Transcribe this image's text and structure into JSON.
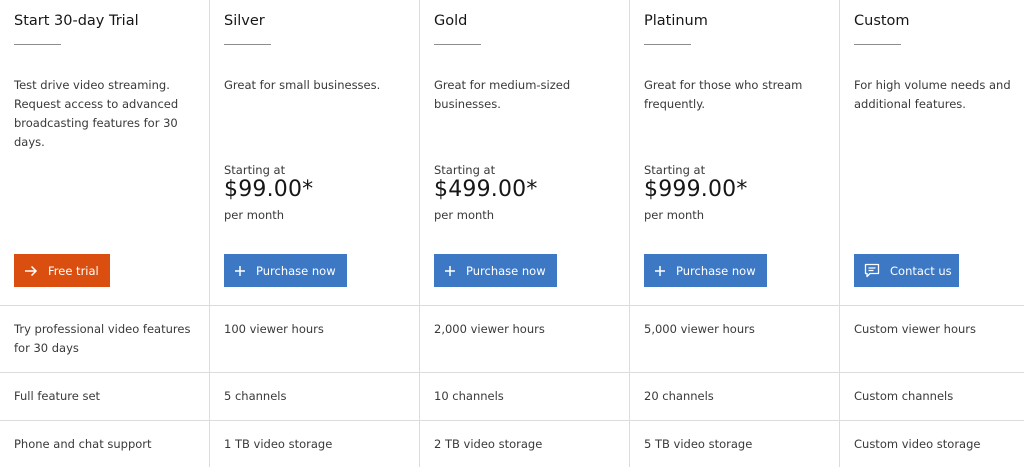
{
  "plans": [
    {
      "title": "Start 30-day Trial",
      "description": "Test drive video streaming. Request access to advanced broadcasting features for 30 days.",
      "cta_label": "Free trial",
      "cta_icon": "arrow-right-icon",
      "features": [
        "Try professional video features for 30 days",
        "Full feature set",
        "Phone and chat support"
      ]
    },
    {
      "title": "Silver",
      "description": "Great for small businesses.",
      "starting_label": "Starting at",
      "price": "$99.00*",
      "period": "per month",
      "cta_label": "Purchase now",
      "cta_icon": "plus-icon",
      "features": [
        "100 viewer hours",
        "5 channels",
        "1 TB video storage"
      ]
    },
    {
      "title": "Gold",
      "description": "Great for medium-sized businesses.",
      "starting_label": "Starting at",
      "price": "$499.00*",
      "period": "per month",
      "cta_label": "Purchase now",
      "cta_icon": "plus-icon",
      "features": [
        "2,000 viewer hours",
        "10 channels",
        "2 TB video storage"
      ]
    },
    {
      "title": "Platinum",
      "description": "Great for those who stream frequently.",
      "starting_label": "Starting at",
      "price": "$999.00*",
      "period": "per month",
      "cta_label": "Purchase now",
      "cta_icon": "plus-icon",
      "features": [
        "5,000 viewer hours",
        "20 channels",
        "5 TB video storage"
      ]
    },
    {
      "title": "Custom",
      "description": "For high volume needs and additional features.",
      "cta_label": "Contact us",
      "cta_icon": "chat-icon",
      "features": [
        "Custom viewer hours",
        "Custom channels",
        "Custom video storage"
      ]
    }
  ],
  "colors": {
    "trial_button": "#da4e0f",
    "purchase_button": "#3d78c4",
    "divider": "#dcdcdc"
  }
}
